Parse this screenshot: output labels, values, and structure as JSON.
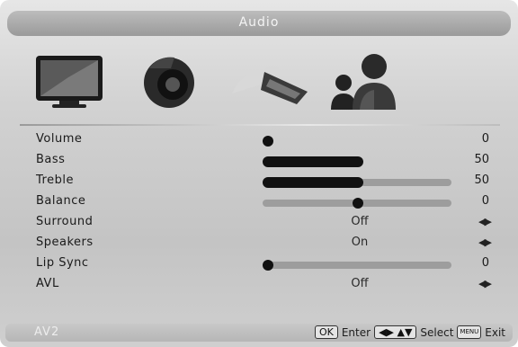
{
  "header": {
    "title": "Audio"
  },
  "icons": [
    "tv-picture-icon",
    "speaker-audio-icon",
    "settings-wrench-icon",
    "users-icon"
  ],
  "menu": [
    {
      "label": "Volume",
      "kind": "slider",
      "value": "0",
      "level": 0.0
    },
    {
      "label": "Bass",
      "kind": "slider",
      "value": "50",
      "level": 0.5
    },
    {
      "label": "Treble",
      "kind": "slider",
      "value": "50",
      "level": 0.5
    },
    {
      "label": "Balance",
      "kind": "balance",
      "value": "0",
      "level": 0.5
    },
    {
      "label": "Surround",
      "kind": "option",
      "value": "Off"
    },
    {
      "label": "Speakers",
      "kind": "option",
      "value": "On"
    },
    {
      "label": "Lip Sync",
      "kind": "slider",
      "value": "0",
      "level": 0.0
    },
    {
      "label": "AVL",
      "kind": "option",
      "value": "Off"
    }
  ],
  "footer": {
    "source": "AV2",
    "ok_key": "OK",
    "enter_label": "Enter",
    "select_label": "Select",
    "menu_key": "MENU",
    "exit_label": "Exit"
  }
}
